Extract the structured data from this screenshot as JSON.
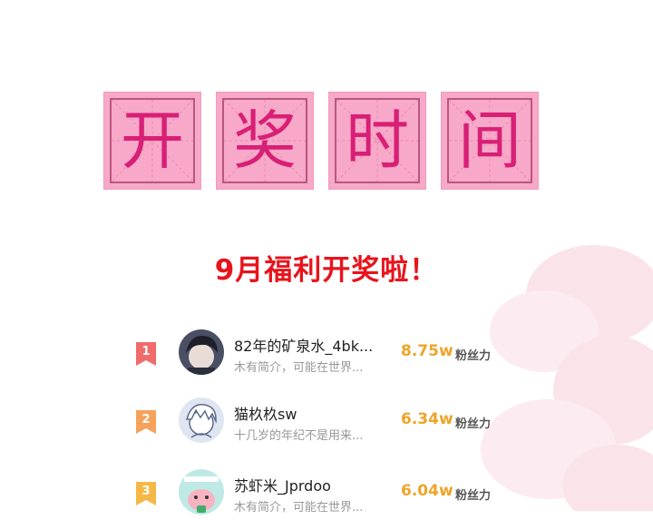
{
  "title_chars": [
    "开",
    "奖",
    "时",
    "间"
  ],
  "subtitle": "9月福利开奖啦！",
  "ranking": [
    {
      "rank": "1",
      "name": "82年的矿泉水_4bk...",
      "bio": "木有简介，可能在世界...",
      "fans": "8.75w",
      "fans_label": "粉丝力",
      "badge_color": "#f26b6b",
      "avatar": "dark-hair-boy-avatar"
    },
    {
      "rank": "2",
      "name": "猫杦杦sw",
      "bio": "十几岁的年纪不是用来...",
      "fans": "6.34w",
      "fans_label": "粉丝力",
      "badge_color": "#f6a25a",
      "avatar": "sketch-boy-avatar"
    },
    {
      "rank": "3",
      "name": "苏虾米_Jprdoo",
      "bio": "木有简介，可能在世界...",
      "fans": "6.04w",
      "fans_label": "粉丝力",
      "badge_color": "#f6b845",
      "avatar": "green-cartoon-avatar"
    }
  ],
  "colors": {
    "tile_bg": "#f8a8c8",
    "tile_char": "#d81f76",
    "subtitle": "#e8141c",
    "fans": "#eea428"
  }
}
